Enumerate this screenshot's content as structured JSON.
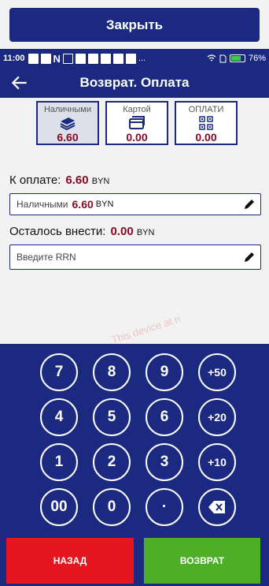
{
  "close_button": {
    "label": "Закрыть"
  },
  "status_bar": {
    "time": "11:00",
    "battery": "76%",
    "more": "..."
  },
  "app_bar": {
    "title": "Возврат. Оплата"
  },
  "payment_methods": [
    {
      "label": "Наличными",
      "amount": "6.60",
      "icon": "cash-icon",
      "active": true
    },
    {
      "label": "Картой",
      "amount": "0.00",
      "icon": "card-icon",
      "active": false
    },
    {
      "label": "ОПЛАТИ",
      "amount": "0.00",
      "icon": "qr-code-icon",
      "active": false
    }
  ],
  "to_pay": {
    "label": "К оплате:",
    "amount": "6.60",
    "currency": "BYN"
  },
  "cash_field": {
    "label": "Наличными",
    "amount": "6.60",
    "currency": "BYN"
  },
  "remaining": {
    "label": "Осталось внести:",
    "amount": "0.00",
    "currency": "BYN"
  },
  "rrn_field": {
    "placeholder": "Введите RRN"
  },
  "watermark": {
    "text": "This device at ri"
  },
  "keypad": {
    "keys": [
      "7",
      "8",
      "9",
      "+50",
      "4",
      "5",
      "6",
      "+20",
      "1",
      "2",
      "3",
      "+10",
      "00",
      "0",
      "·",
      "⌫"
    ]
  },
  "actions": {
    "back": "НАЗАД",
    "refund": "ВОЗВРАТ"
  },
  "colors": {
    "primary": "#1b2a80",
    "amount": "#8a0a24",
    "danger": "#e5161f",
    "success": "#4caf26"
  }
}
